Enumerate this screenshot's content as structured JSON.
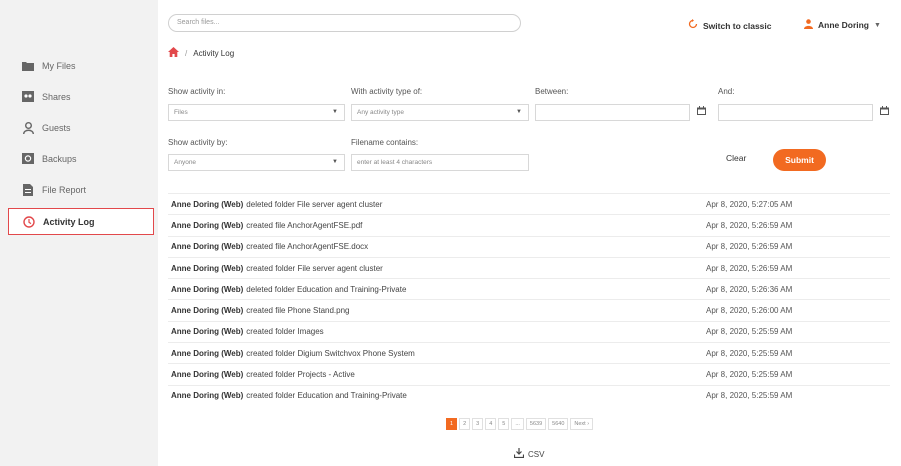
{
  "sidebar": {
    "items": [
      {
        "label": "My Files",
        "icon": "folder-icon"
      },
      {
        "label": "Shares",
        "icon": "shares-icon"
      },
      {
        "label": "Guests",
        "icon": "user-icon"
      },
      {
        "label": "Backups",
        "icon": "backup-icon"
      },
      {
        "label": "File Report",
        "icon": "report-icon"
      },
      {
        "label": "Activity Log",
        "icon": "clock-icon",
        "active": true
      }
    ]
  },
  "header": {
    "search_placeholder": "Search files...",
    "switch_label": "Switch to classic",
    "user_name": "Anne Doring"
  },
  "breadcrumb": {
    "page": "Activity Log"
  },
  "filters": {
    "show_in_label": "Show activity in:",
    "show_in_value": "Files",
    "type_label": "With activity type of:",
    "type_value": "Any activity type",
    "between_label": "Between:",
    "and_label": "And:",
    "by_label": "Show activity by:",
    "by_value": "Anyone",
    "filename_label": "Filename contains:",
    "filename_placeholder": "enter at least 4 characters",
    "clear_label": "Clear",
    "submit_label": "Submit"
  },
  "activities": [
    {
      "actor": "Anne Doring (Web)",
      "action": "deleted folder File server agent cluster",
      "date": "Apr 8, 2020, 5:27:05 AM"
    },
    {
      "actor": "Anne Doring (Web)",
      "action": "created file AnchorAgentFSE.pdf",
      "date": "Apr 8, 2020, 5:26:59 AM"
    },
    {
      "actor": "Anne Doring (Web)",
      "action": "created file AnchorAgentFSE.docx",
      "date": "Apr 8, 2020, 5:26:59 AM"
    },
    {
      "actor": "Anne Doring (Web)",
      "action": "created folder File server agent cluster",
      "date": "Apr 8, 2020, 5:26:59 AM"
    },
    {
      "actor": "Anne Doring (Web)",
      "action": "deleted folder Education and Training-Private",
      "date": "Apr 8, 2020, 5:26:36 AM"
    },
    {
      "actor": "Anne Doring (Web)",
      "action": "created file Phone Stand.png",
      "date": "Apr 8, 2020, 5:26:00 AM"
    },
    {
      "actor": "Anne Doring (Web)",
      "action": "created folder Images",
      "date": "Apr 8, 2020, 5:25:59 AM"
    },
    {
      "actor": "Anne Doring (Web)",
      "action": "created folder Digium Switchvox Phone System",
      "date": "Apr 8, 2020, 5:25:59 AM"
    },
    {
      "actor": "Anne Doring (Web)",
      "action": "created folder Projects - Active",
      "date": "Apr 8, 2020, 5:25:59 AM"
    },
    {
      "actor": "Anne Doring (Web)",
      "action": "created folder Education and Training-Private",
      "date": "Apr 8, 2020, 5:25:59 AM"
    }
  ],
  "pagination": {
    "pages": [
      "1",
      "2",
      "3",
      "4",
      "5",
      "...",
      "5639",
      "5640",
      "Next ›"
    ],
    "current": "1"
  },
  "csv_label": "CSV",
  "colors": {
    "accent": "#f26a21",
    "active_border": "#e2484b",
    "sidebar_bg": "#f2f2f2"
  }
}
